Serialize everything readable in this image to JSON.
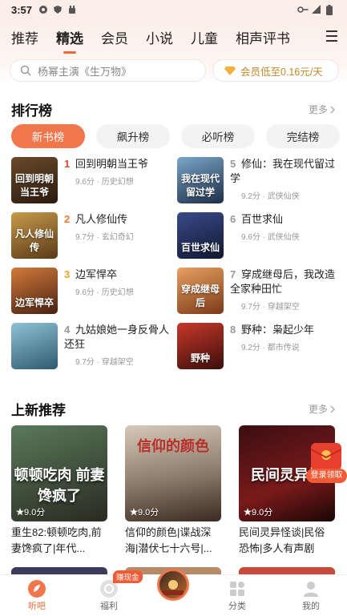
{
  "status_bar": {
    "time": "3:57"
  },
  "tabs": [
    {
      "label": "推荐"
    },
    {
      "label": "精选",
      "active": true
    },
    {
      "label": "会员"
    },
    {
      "label": "小说"
    },
    {
      "label": "儿童"
    },
    {
      "label": "相声评书"
    }
  ],
  "search": {
    "placeholder_text": "杨幂主演《生万物》"
  },
  "vip_promo": {
    "label": "会员低至0.16元/天"
  },
  "ranking": {
    "title": "排行榜",
    "more": "更多",
    "pills": [
      {
        "label": "新书榜",
        "active": true
      },
      {
        "label": "飙升榜"
      },
      {
        "label": "必听榜"
      },
      {
        "label": "完结榜"
      }
    ],
    "items": [
      {
        "rank": "1",
        "title": "回到明朝当王爷",
        "meta": "9.6分 · 历史幻想",
        "cover_text": "回到明朝当王爷"
      },
      {
        "rank": "2",
        "title": "凡人修仙传",
        "meta": "9.7分 · 玄幻奇幻",
        "cover_text": "凡人修仙传"
      },
      {
        "rank": "3",
        "title": "边军悍卒",
        "meta": "9.6分 · 历史幻想",
        "cover_text": "边军悍卒"
      },
      {
        "rank": "4",
        "title": "九姑娘她一身反骨人还狂",
        "meta": "9.7分 · 穿越架空",
        "cover_text": ""
      },
      {
        "rank": "5",
        "title": "修仙：我在现代留过学",
        "meta": "9.2分 · 武侠仙侠",
        "cover_text": "我在现代留过学"
      },
      {
        "rank": "6",
        "title": "百世求仙",
        "meta": "9.6分 · 武侠仙侠",
        "cover_text": "百世求仙"
      },
      {
        "rank": "7",
        "title": "穿成继母后，我改造全家种田忙",
        "meta": "9.7分 · 穿越架空",
        "cover_text": "穿成继母后"
      },
      {
        "rank": "8",
        "title": "野种：枭起少年",
        "meta": "9.2分 · 都市传说",
        "cover_text": "野种"
      }
    ]
  },
  "new_releases": {
    "title": "上新推荐",
    "more": "更多",
    "items": [
      {
        "title": "重生82:顿顿吃肉,前妻馋疯了|年代...",
        "score": "9.0分",
        "cover_text": "顿顿吃肉 前妻馋疯了"
      },
      {
        "title": "信仰的颜色|谍战深海|潜伏七十六号|...",
        "score": "9.0分",
        "cover_text": "信仰的颜色"
      },
      {
        "title": "民间灵异怪谈|民俗恐怖|多人有声剧",
        "score": "9.0分",
        "cover_text": "民间灵异怪"
      }
    ]
  },
  "float_badge": {
    "label": "登录领取"
  },
  "bottom_nav": {
    "items": [
      {
        "label": "听吧",
        "active": true
      },
      {
        "label": "福利"
      },
      {
        "label": ""
      },
      {
        "label": "分类"
      },
      {
        "label": "我的"
      }
    ],
    "welfare_badge": "赚现金"
  },
  "colors": {
    "accent": "#f2764b",
    "rank_top": "#e8452e",
    "gold": "#c0882a"
  }
}
